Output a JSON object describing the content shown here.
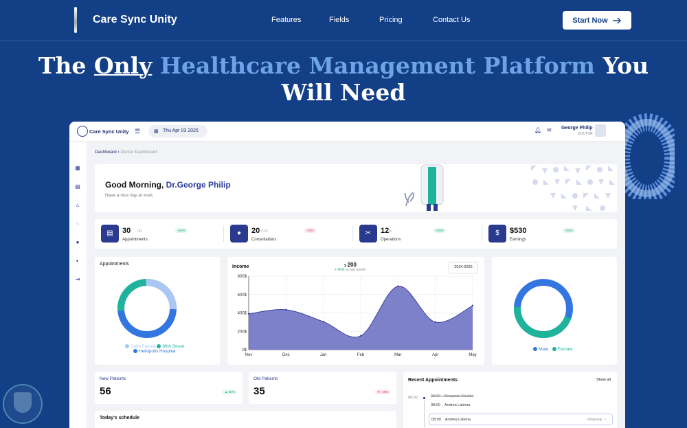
{
  "site": {
    "logo_text": "Care Sync Unity",
    "nav": [
      "Features",
      "Fields",
      "Pricing",
      "Contact Us"
    ],
    "cta": "Start Now"
  },
  "hero": {
    "part1": "The",
    "part2": "Only",
    "part3": "Healthcare Management Platform",
    "part4": "You",
    "line2": "Will Need"
  },
  "app": {
    "name": "Care Sync Unity",
    "date": "Thu Apr 03 2025",
    "user_name": "George Philip",
    "user_role": "DOCTOR",
    "breadcrumb": [
      "Dashboard",
      "Doctor Dashboard"
    ],
    "greeting_prefix": "Good Morning,",
    "greeting_name": "Dr.George Philip",
    "greeting_sub": "Have a nice day at work",
    "stats": [
      {
        "value": "30",
        "sub": "/43",
        "label": "Appointments",
        "badge": "+60%",
        "trend": "pos",
        "icon": "calendar-icon"
      },
      {
        "value": "20",
        "sub": "/125",
        "label": "Consultations",
        "badge": "-20%",
        "trend": "neg",
        "icon": "stethoscope-icon"
      },
      {
        "value": "12",
        "sub": "/30",
        "label": "Operations",
        "badge": "+40%",
        "trend": "pos",
        "icon": "scissors-icon"
      },
      {
        "value": "$530",
        "sub": "",
        "label": "Earnings",
        "badge": "+50%",
        "trend": "pos",
        "icon": "wallet-icon"
      }
    ],
    "appointments_card": {
      "title": "Appointments",
      "legend": [
        "Saint Fatima",
        "90th Street",
        "Heliopolis Hospital"
      ],
      "colors": [
        "#a9c7f2",
        "#1fb39c",
        "#3476e0"
      ]
    },
    "gender_card": {
      "legend": [
        "Male",
        "Female"
      ],
      "colors": [
        "#3476e0",
        "#1fb39c"
      ]
    },
    "income": {
      "title": "Income",
      "amount_prefix": "$",
      "amount": "200",
      "change": "+ 40%",
      "change_note": "vs last month",
      "range": "2024-2025"
    },
    "new_patients": {
      "label": "New Patients",
      "value": "56",
      "badge": "▲ 60%"
    },
    "old_patients": {
      "label": "Old Patients",
      "value": "35",
      "badge": "▼ -20%"
    },
    "recent": {
      "title": "Recent Appointments",
      "show_all": "Show all",
      "time_label": "08:00",
      "rows": [
        {
          "time": "08:00",
          "name": "Benjamin Shuklin"
        },
        {
          "time": "08:00",
          "name": "Andrea Lalema"
        },
        {
          "time": "08:00",
          "name": "Andrea Lalema",
          "status": "Ongoing"
        }
      ]
    },
    "schedule_title": "Today's schedule"
  },
  "chart_data": {
    "type": "area",
    "title": "Income",
    "x": [
      "Nov",
      "Dec",
      "Jan",
      "Feb",
      "Mar",
      "Apr",
      "May"
    ],
    "ylim": [
      0,
      800
    ],
    "yticks": [
      "0$",
      "200$",
      "400$",
      "600$",
      "800$"
    ],
    "series": [
      {
        "values": [
          390,
          435,
          305,
          150,
          690,
          300,
          480
        ]
      }
    ],
    "grid": true,
    "color": "#6f73c4"
  }
}
